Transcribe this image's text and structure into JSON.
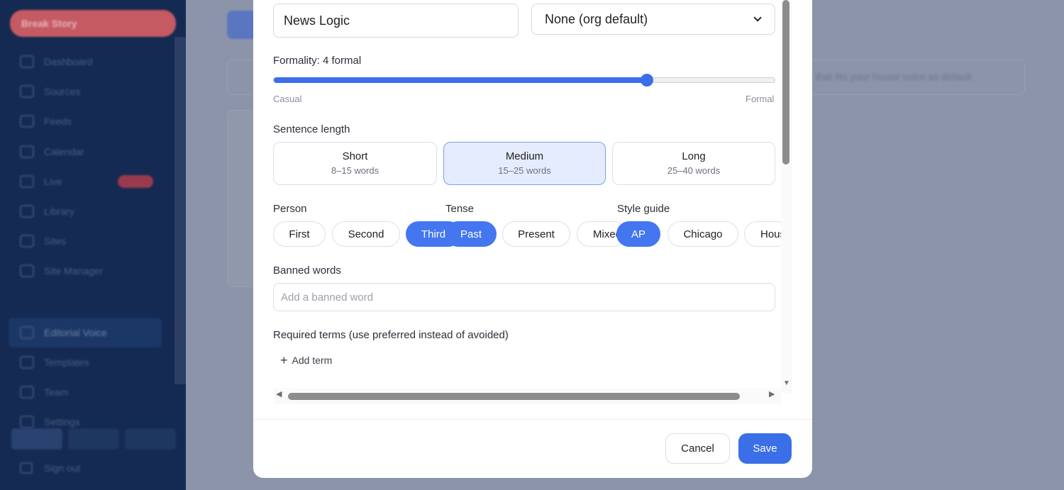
{
  "background": {
    "brand_label": "Break Story",
    "nav_items": [
      {
        "label": "Dashboard"
      },
      {
        "label": "Sources"
      },
      {
        "label": "Feeds"
      },
      {
        "label": "Calendar"
      },
      {
        "label": "Live"
      },
      {
        "label": "Library"
      },
      {
        "label": "Sites"
      },
      {
        "label": "Site Manager"
      }
    ],
    "nav_items_secondary": [
      {
        "label": "Editorial Voice"
      },
      {
        "label": "Templates"
      },
      {
        "label": "Team"
      },
      {
        "label": "Settings"
      }
    ],
    "sign_out": "Sign out",
    "banner_text": "that fits your house voice as default."
  },
  "modal": {
    "name_value": "News Logic",
    "base_select_value": "None (org default)",
    "formality": {
      "label": "Formality: 4 formal",
      "value": 4,
      "fraction": 0.745,
      "min_label": "Casual",
      "max_label": "Formal"
    },
    "sentence_length": {
      "label": "Sentence length",
      "options": [
        {
          "title": "Short",
          "subtitle": "8–15 words"
        },
        {
          "title": "Medium",
          "subtitle": "15–25 words"
        },
        {
          "title": "Long",
          "subtitle": "25–40 words"
        }
      ],
      "selected": "Medium"
    },
    "person": {
      "label": "Person",
      "options": [
        "First",
        "Second",
        "Third",
        "Mixed"
      ],
      "selected": "Third"
    },
    "tense": {
      "label": "Tense",
      "options": [
        "Past",
        "Present"
      ],
      "selected": "Past"
    },
    "style_guide": {
      "label": "Style guide",
      "options": [
        "AP",
        "Chicago",
        "House"
      ],
      "selected": "AP"
    },
    "banned_words": {
      "label": "Banned words",
      "placeholder": "Add a banned word"
    },
    "required_terms": {
      "label": "Required terms (use preferred instead of avoided)",
      "add_label": "Add term"
    },
    "cancel_label": "Cancel",
    "save_label": "Save"
  },
  "colors": {
    "accent": "#3b6fe8",
    "sidebar": "#142a52",
    "overlay": "#8b94a8"
  }
}
